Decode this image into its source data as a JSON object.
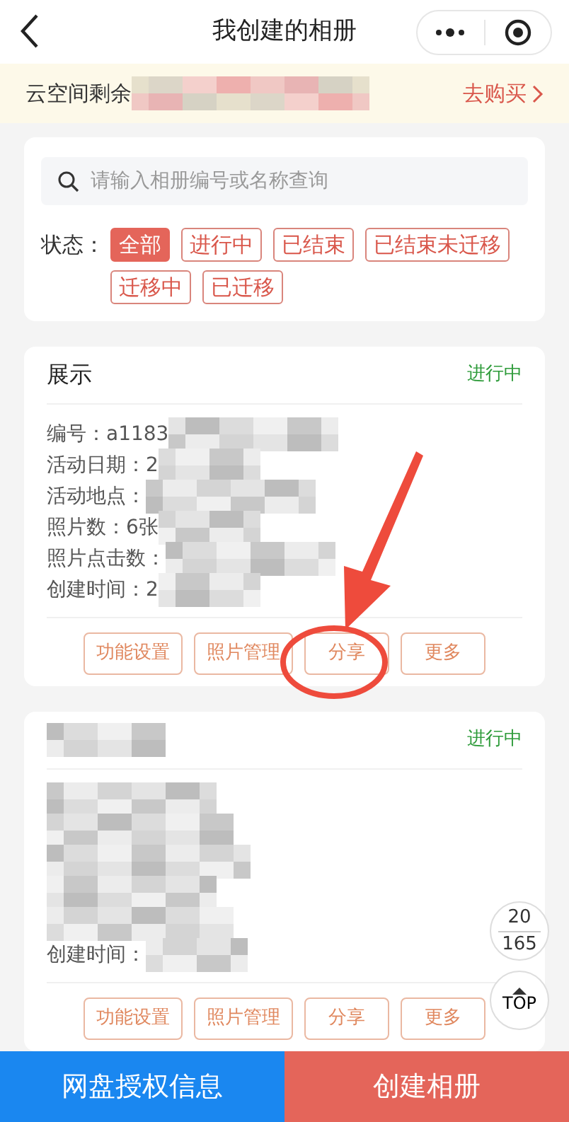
{
  "nav": {
    "title": "我创建的相册"
  },
  "banner": {
    "label": "云空间剩余",
    "action": "去购买"
  },
  "search": {
    "placeholder": "请输入相册编号或名称查询"
  },
  "filter": {
    "label": "状态：",
    "options": [
      {
        "label": "全部",
        "selected": true
      },
      {
        "label": "进行中",
        "selected": false
      },
      {
        "label": "已结束",
        "selected": false
      },
      {
        "label": "已结束未迁移",
        "selected": false
      },
      {
        "label": "迁移中",
        "selected": false
      },
      {
        "label": "已迁移",
        "selected": false
      }
    ]
  },
  "albums": [
    {
      "title": "展示",
      "status": "进行中",
      "fields": [
        {
          "kind": "text",
          "text": "编号：a1183"
        },
        {
          "kind": "text",
          "text": "活动日期：2"
        },
        {
          "kind": "text",
          "text": "活动地点："
        },
        {
          "kind": "text",
          "text": "照片数：6张"
        },
        {
          "kind": "text",
          "text": "照片点击数："
        },
        {
          "kind": "text",
          "text": "创建时间：2"
        }
      ],
      "buttons": [
        "功能设置",
        "照片管理",
        "分享",
        "更多"
      ]
    },
    {
      "status": "进行中",
      "fields": [
        {
          "kind": "redacted"
        },
        {
          "kind": "redacted"
        },
        {
          "kind": "redacted"
        },
        {
          "kind": "redacted"
        },
        {
          "kind": "redacted"
        },
        {
          "kind": "text",
          "text": "创建时间："
        }
      ],
      "buttons": [
        "功能设置",
        "照片管理",
        "分享",
        "更多"
      ]
    }
  ],
  "pager": {
    "current": "20",
    "total": "165"
  },
  "top_button": "TOP",
  "bottom_bar": [
    {
      "kind": "secondary",
      "label": "网盘授权信息"
    },
    {
      "kind": "primary",
      "label": "创建相册"
    }
  ]
}
